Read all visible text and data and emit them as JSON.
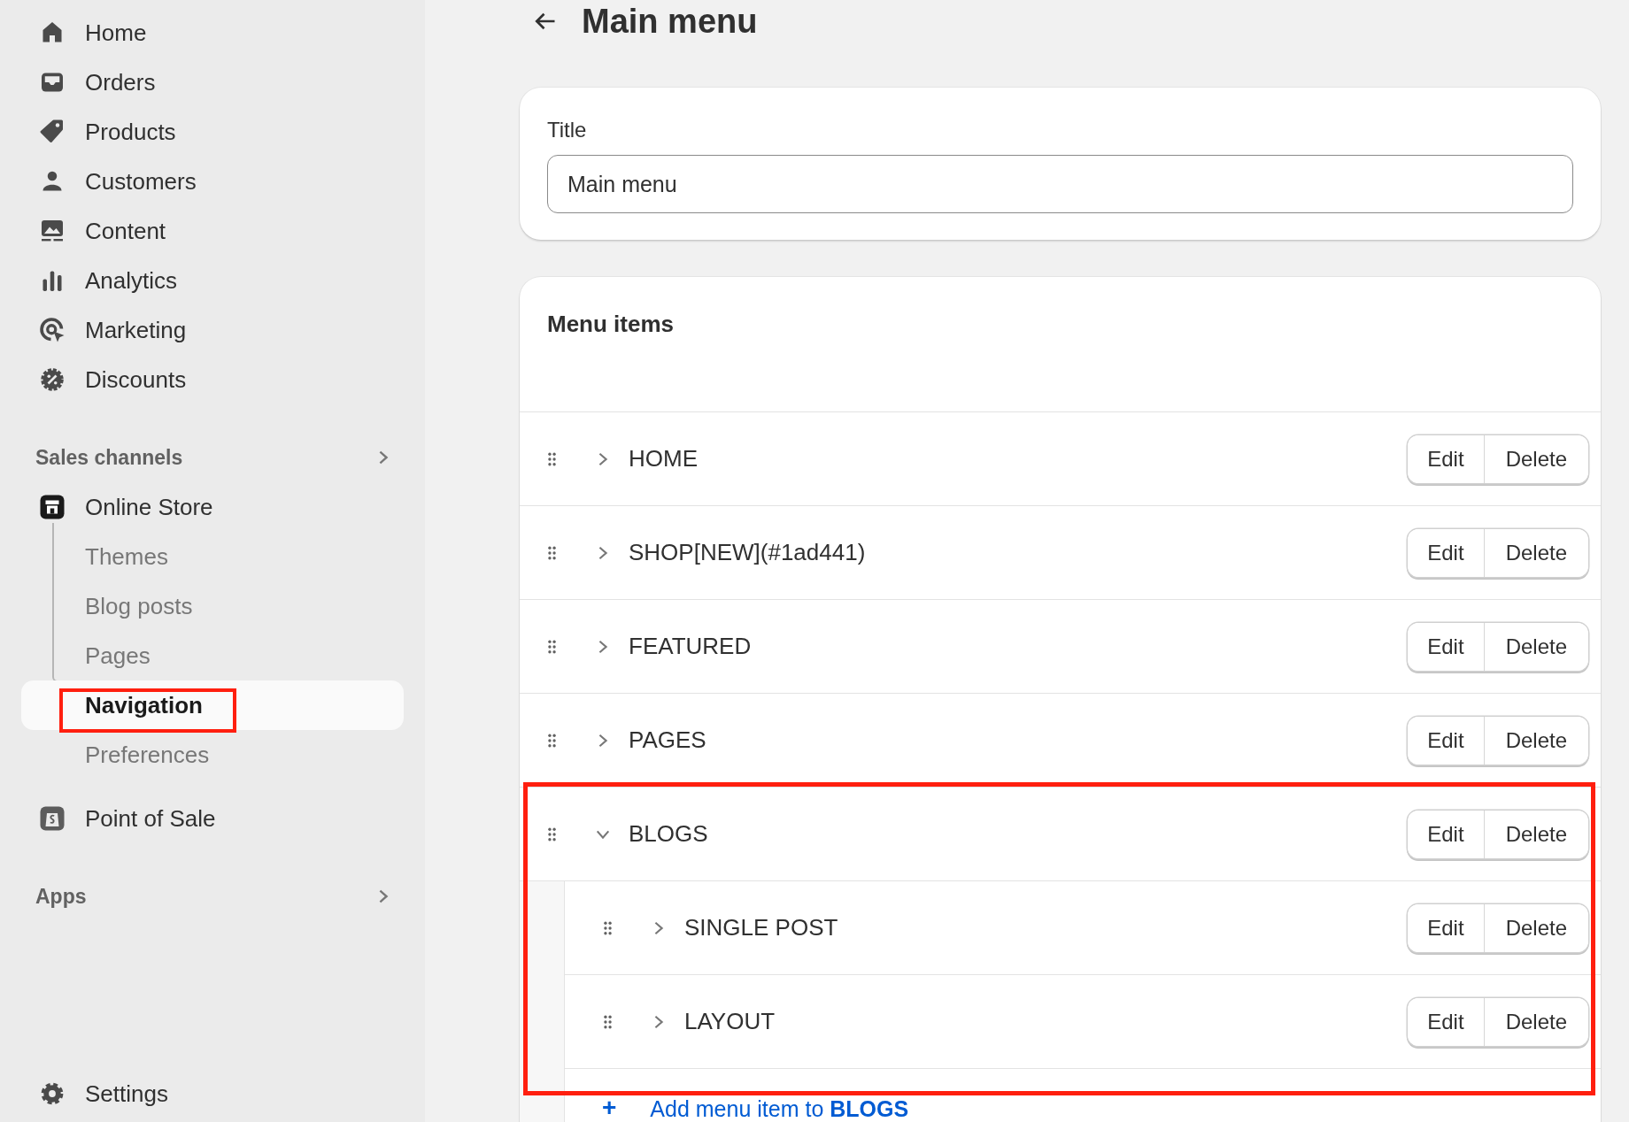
{
  "sidebar": {
    "items": [
      {
        "label": "Home",
        "kind": "home"
      },
      {
        "label": "Orders",
        "kind": "inbox"
      },
      {
        "label": "Products",
        "kind": "tag"
      },
      {
        "label": "Customers",
        "kind": "person"
      },
      {
        "label": "Content",
        "kind": "image"
      },
      {
        "label": "Analytics",
        "kind": "bars"
      },
      {
        "label": "Marketing",
        "kind": "target"
      },
      {
        "label": "Discounts",
        "kind": "discount"
      }
    ],
    "sales_channels": {
      "label": "Sales channels",
      "channels": [
        {
          "label": "Online Store",
          "kind": "store",
          "children": [
            {
              "label": "Themes",
              "selected": false,
              "highlighted": false
            },
            {
              "label": "Blog posts",
              "selected": false,
              "highlighted": false
            },
            {
              "label": "Pages",
              "selected": false,
              "highlighted": false
            },
            {
              "label": "Navigation",
              "selected": true,
              "highlighted": true
            },
            {
              "label": "Preferences",
              "selected": false,
              "highlighted": false
            }
          ]
        },
        {
          "label": "Point of Sale",
          "kind": "bag"
        }
      ]
    },
    "apps": {
      "label": "Apps"
    },
    "settings": {
      "label": "Settings"
    }
  },
  "page": {
    "title": "Main menu",
    "title_field": {
      "label": "Title",
      "value": "Main menu"
    },
    "menu_items": {
      "heading": "Menu items",
      "items": [
        {
          "label": "HOME",
          "expanded": false,
          "highlighted": false,
          "actions": [
            "Edit",
            "Delete"
          ]
        },
        {
          "label": "SHOP[NEW](#1ad441)",
          "expanded": false,
          "highlighted": false,
          "actions": [
            "Edit",
            "Delete"
          ]
        },
        {
          "label": "FEATURED",
          "expanded": false,
          "highlighted": false,
          "actions": [
            "Edit",
            "Delete"
          ]
        },
        {
          "label": "PAGES",
          "expanded": false,
          "highlighted": false,
          "actions": [
            "Edit",
            "Delete"
          ]
        },
        {
          "label": "BLOGS",
          "expanded": true,
          "highlighted": true,
          "actions": [
            "Edit",
            "Delete"
          ],
          "children": [
            {
              "label": "SINGLE POST",
              "expanded": false,
              "actions": [
                "Edit",
                "Delete"
              ]
            },
            {
              "label": "LAYOUT",
              "expanded": false,
              "actions": [
                "Edit",
                "Delete"
              ]
            }
          ],
          "add_link": {
            "icon": "+",
            "text": "Add menu item to **BLOGS**"
          }
        }
      ]
    }
  }
}
